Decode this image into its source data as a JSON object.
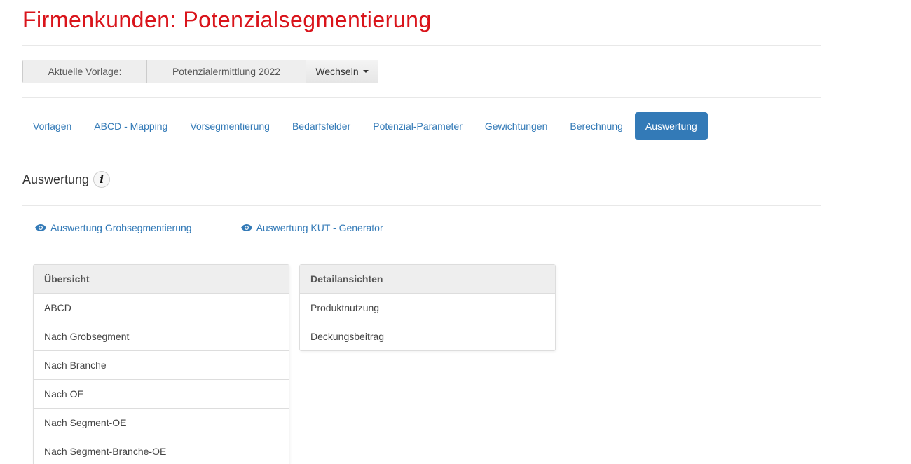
{
  "page": {
    "title": "Firmenkunden: Potenzialsegmentierung"
  },
  "template": {
    "label": "Aktuelle Vorlage:",
    "value": "Potenzialermittlung 2022",
    "switch_label": "Wechseln"
  },
  "tabs": [
    {
      "label": "Vorlagen",
      "active": false
    },
    {
      "label": "ABCD - Mapping",
      "active": false
    },
    {
      "label": "Vorsegmentierung",
      "active": false
    },
    {
      "label": "Bedarfsfelder",
      "active": false
    },
    {
      "label": "Potenzial-Parameter",
      "active": false
    },
    {
      "label": "Gewichtungen",
      "active": false
    },
    {
      "label": "Berechnung",
      "active": false
    },
    {
      "label": "Auswertung",
      "active": true
    }
  ],
  "section": {
    "title": "Auswertung",
    "info_icon": "info-icon"
  },
  "links": [
    {
      "label": "Auswertung Grobsegmentierung",
      "icon": "eye-icon"
    },
    {
      "label": "Auswertung KUT - Generator",
      "icon": "eye-icon"
    }
  ],
  "overview": {
    "heading": "Übersicht",
    "items": [
      "ABCD",
      "Nach Grobsegment",
      "Nach Branche",
      "Nach OE",
      "Nach Segment-OE",
      "Nach Segment-Branche-OE"
    ]
  },
  "details": {
    "heading": "Detailansichten",
    "items": [
      "Produktnutzung",
      "Deckungsbeitrag"
    ]
  },
  "colors": {
    "title_red": "#d9141b",
    "link_blue": "#337ab7",
    "active_tab_bg": "#337ab7"
  }
}
